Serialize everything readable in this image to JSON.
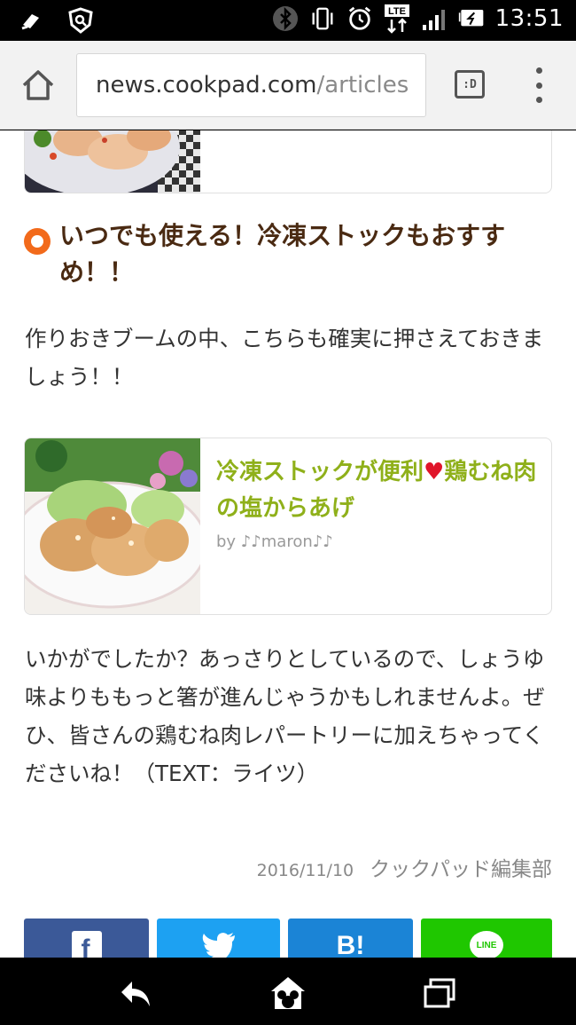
{
  "status_bar": {
    "time": "13:51",
    "network": "LTE"
  },
  "browser": {
    "url_host": "news.cookpad.com",
    "url_path": "/articles",
    "tabs_label": ":D"
  },
  "article": {
    "heading": "いつでも使える！冷凍ストックもおすすめ！！",
    "paragraph1": "作りおきブームの中、こちらも確実に押さえておきましょう！！",
    "recipe_card": {
      "title_part1": "冷凍ストックが便利",
      "heart": "♥",
      "title_part2": "鶏むね肉の塩からあげ",
      "author": "by ♪♪maron♪♪"
    },
    "paragraph2": "いかがでしたか？あっさりとしているので、しょうゆ味よりももっと箸が進んじゃうかもしれませんよ。ぜひ、皆さんの鶏むね肉レパートリーに加えちゃってくださいね！（TEXT：ライツ）",
    "date": "2016/11/10",
    "author": "クックパッド編集部"
  },
  "share": {
    "facebook": "f",
    "hatena": "B!",
    "line": "LINE"
  },
  "colors": {
    "heading": "#4a2a12",
    "recipe_title": "#8fb01a",
    "heart": "#e0152a",
    "bullet": "#f26a1b",
    "facebook": "#3b5998",
    "twitter": "#1da1f2",
    "hatena": "#1b84d6",
    "line": "#1fc700"
  },
  "icons": [
    "notification-icon",
    "shield-icon",
    "bluetooth-icon",
    "vibrate-icon",
    "alarm-icon",
    "signal-icon",
    "battery-icon",
    "home-icon",
    "more-icon",
    "back-icon",
    "home-nav-icon",
    "recent-apps-icon"
  ]
}
